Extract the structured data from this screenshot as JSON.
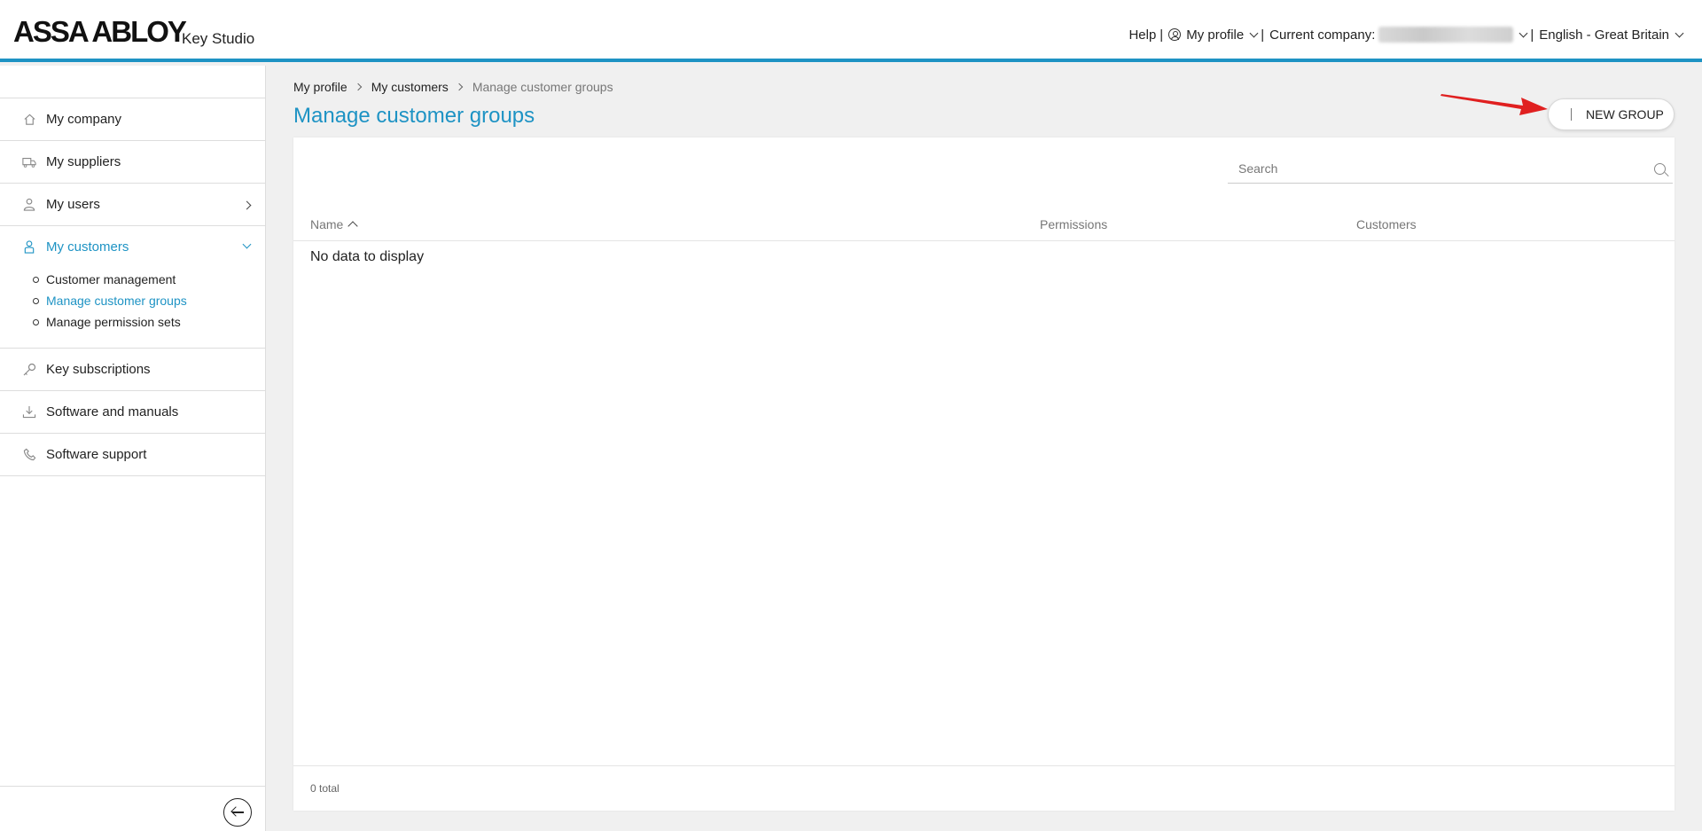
{
  "header": {
    "logo": "ASSA ABLOY",
    "app_name": "Key Studio",
    "help": "Help",
    "sep": "|",
    "my_profile": "My profile",
    "current_company_label": "Current company:",
    "language": "English - Great Britain"
  },
  "sidebar": {
    "items": [
      {
        "label": "My company",
        "icon": "home-icon"
      },
      {
        "label": "My suppliers",
        "icon": "truck-icon"
      },
      {
        "label": "My users",
        "icon": "user-icon"
      },
      {
        "label": "My customers",
        "icon": "customers-icon"
      },
      {
        "label": "Key subscriptions",
        "icon": "key-icon"
      },
      {
        "label": "Software and manuals",
        "icon": "download-icon"
      },
      {
        "label": "Software support",
        "icon": "phone-icon"
      }
    ],
    "sub_items": [
      "Customer management",
      "Manage customer groups",
      "Manage permission sets"
    ]
  },
  "breadcrumb": [
    "My profile",
    "My customers",
    "Manage customer groups"
  ],
  "page_title": "Manage customer groups",
  "new_group_label": "NEW GROUP",
  "search": {
    "placeholder": "Search",
    "value": ""
  },
  "table": {
    "columns": [
      "Name",
      "Permissions",
      "Customers"
    ],
    "empty_text": "No data to display",
    "total": "0 total"
  },
  "colors": {
    "accent": "#1e93c4",
    "annotation_arrow": "#e02020"
  }
}
